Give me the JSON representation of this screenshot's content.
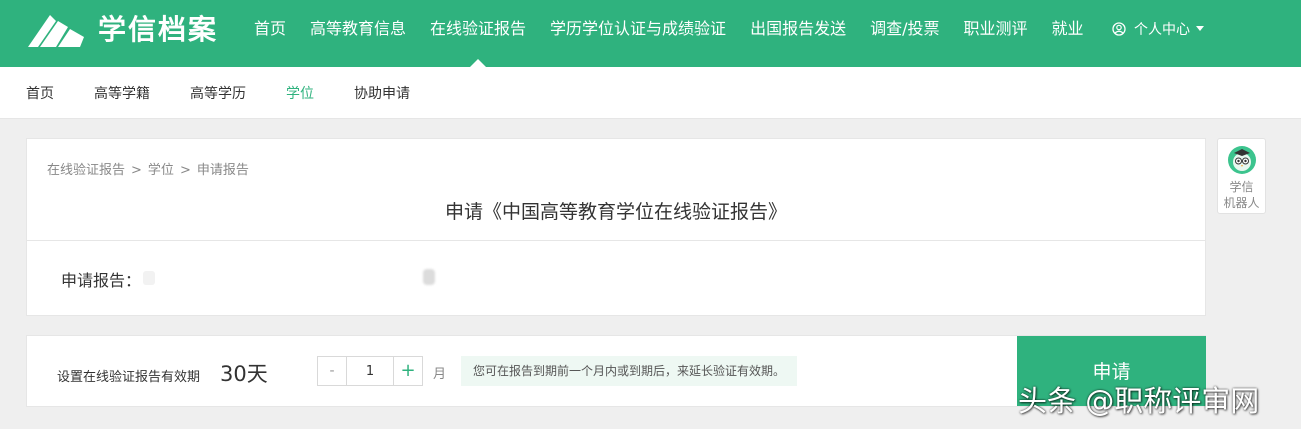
{
  "header": {
    "logo_text": "学信档案",
    "nav": [
      {
        "label": "首页"
      },
      {
        "label": "高等教育信息"
      },
      {
        "label": "在线验证报告",
        "active": true
      },
      {
        "label": "学历学位认证与成绩验证"
      },
      {
        "label": "出国报告发送"
      },
      {
        "label": "调查/投票"
      },
      {
        "label": "职业测评"
      },
      {
        "label": "就业"
      }
    ],
    "user_center": "个人中心"
  },
  "subnav": [
    {
      "label": "首页"
    },
    {
      "label": "高等学籍"
    },
    {
      "label": "高等学历"
    },
    {
      "label": "学位",
      "active": true
    },
    {
      "label": "协助申请"
    }
  ],
  "breadcrumb": [
    "在线验证报告",
    "学位",
    "申请报告"
  ],
  "breadcrumb_sep": ">",
  "main": {
    "title": "申请《中国高等教育学位在线验证报告》",
    "apply_label": "申请报告："
  },
  "validity": {
    "label": "设置在线验证报告有效期",
    "days": "30天",
    "minus": "-",
    "plus": "+",
    "months_value": "1",
    "unit": "月",
    "hint": "您可在报告到期前一个月内或到期后，来延长验证有效期。",
    "apply_button": "申请"
  },
  "robot": {
    "label_line1": "学信",
    "label_line2": "机器人"
  },
  "watermark": "头条 @职称评审网",
  "colors": {
    "brand": "#2fb27e",
    "hint_bg": "#eef8f3"
  }
}
